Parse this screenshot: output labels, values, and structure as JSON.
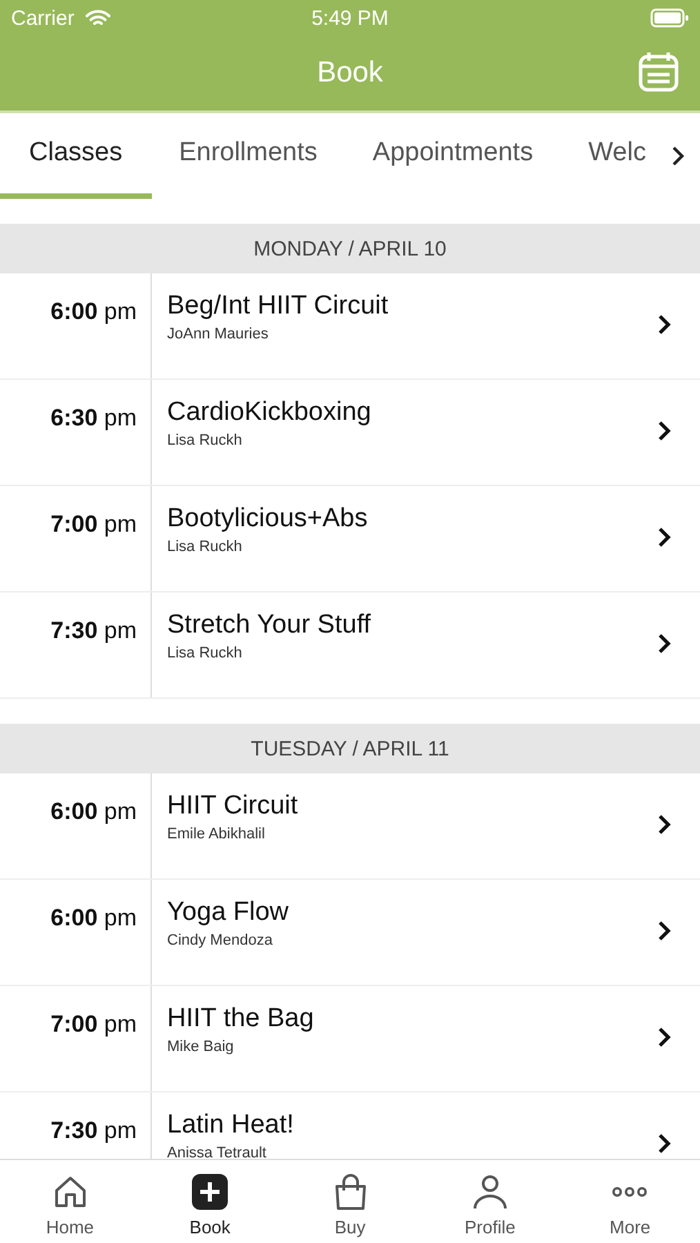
{
  "status_bar": {
    "carrier": "Carrier",
    "time": "5:49 PM"
  },
  "nav_bar": {
    "title": "Book"
  },
  "tabs": [
    {
      "label": "Classes",
      "selected": true
    },
    {
      "label": "Enrollments",
      "selected": false
    },
    {
      "label": "Appointments",
      "selected": false
    },
    {
      "label": "Welc",
      "selected": false
    }
  ],
  "days": [
    {
      "heading": "MONDAY / APRIL 10",
      "classes": [
        {
          "time": "**6:00** pm",
          "name": "Beg/Int HIIT Circuit",
          "instructor": "JoAnn Mauries"
        },
        {
          "time": "**6:30** pm",
          "name": "CardioKickboxing",
          "instructor": "Lisa Ruckh"
        },
        {
          "time": "**7:00** pm",
          "name": "Bootylicious+Abs",
          "instructor": "Lisa Ruckh"
        },
        {
          "time": "**7:30** pm",
          "name": "Stretch Your Stuff",
          "instructor": "Lisa Ruckh"
        }
      ]
    },
    {
      "heading": "TUESDAY / APRIL 11",
      "classes": [
        {
          "time": "**6:00** pm",
          "name": "HIIT Circuit",
          "instructor": "Emile Abikhalil"
        },
        {
          "time": "**6:00** pm",
          "name": "Yoga Flow",
          "instructor": "Cindy Mendoza"
        },
        {
          "time": "**7:00** pm",
          "name": "HIIT the Bag",
          "instructor": "Mike Baig"
        },
        {
          "time": "**7:30** pm",
          "name": "Latin Heat!",
          "instructor": "Anissa Tetrault"
        }
      ]
    }
  ],
  "tab_bar": [
    {
      "kind": "home",
      "label": "Home",
      "selected": false
    },
    {
      "kind": "book",
      "label": "Book",
      "selected": true
    },
    {
      "kind": "buy",
      "label": "Buy",
      "selected": false
    },
    {
      "kind": "profile",
      "label": "Profile",
      "selected": false
    },
    {
      "kind": "more",
      "label": "More",
      "selected": false
    }
  ]
}
